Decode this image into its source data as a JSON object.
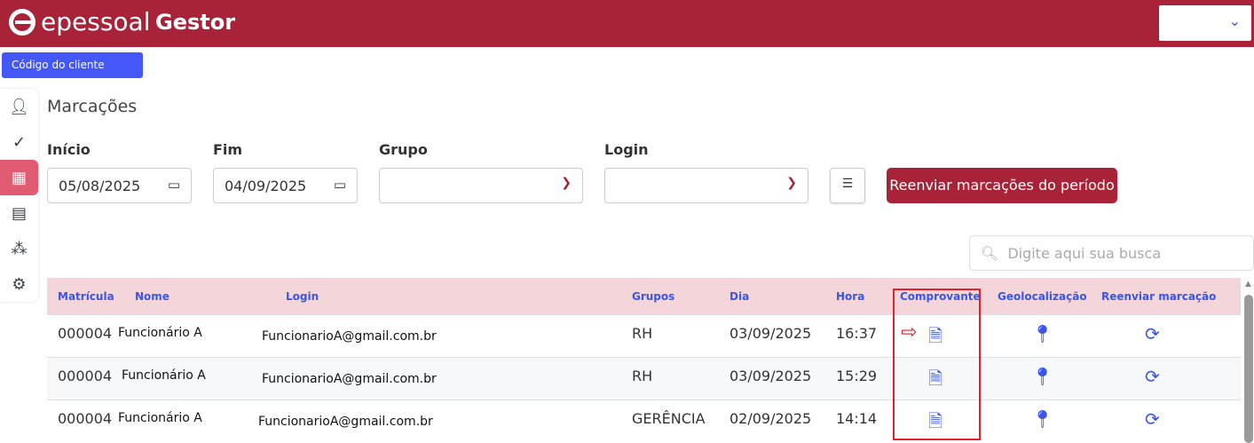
{
  "header": {
    "brand": "epessoal",
    "app": "Gestor"
  },
  "client_button": "Código do cliente",
  "sidebar": [
    "user-icon",
    "check-icon",
    "timesheet-icon",
    "document-icon",
    "team-icon",
    "gear-icon"
  ],
  "page_title": "Marcações",
  "filters": {
    "inicio_label": "Início",
    "inicio_value": "05/08/2025",
    "fim_label": "Fim",
    "fim_value": "04/09/2025",
    "grupo_label": "Grupo",
    "grupo_value": "",
    "login_label": "Login",
    "login_value": ""
  },
  "resend_button": "Reenviar marcações do período",
  "search_placeholder": "Digite aqui sua busca",
  "columns": [
    "Matrícula",
    "Nome",
    "Login",
    "Grupos",
    "Dia",
    "Hora",
    "Comprovante",
    "Geolocalização",
    "Reenviar marcação"
  ],
  "rows": [
    {
      "matricula": "000004",
      "nome": "Funcionário A",
      "login": "FuncionarioA@gmail.com.br",
      "grupo": "RH",
      "dia": "03/09/2025",
      "hora": "16:37"
    },
    {
      "matricula": "000004",
      "nome": "Funcionário A",
      "login": "FuncionarioA@gmail.com.br",
      "grupo": "RH",
      "dia": "03/09/2025",
      "hora": "15:29"
    },
    {
      "matricula": "000004",
      "nome": "Funcionário A",
      "login": "FuncionarioA@gmail.com.br",
      "grupo": "GERÊNCIA",
      "dia": "02/09/2025",
      "hora": "14:14"
    }
  ],
  "colors": {
    "brand": "#a82338",
    "accent": "#3b55e6",
    "highlight": "#e8202a"
  }
}
